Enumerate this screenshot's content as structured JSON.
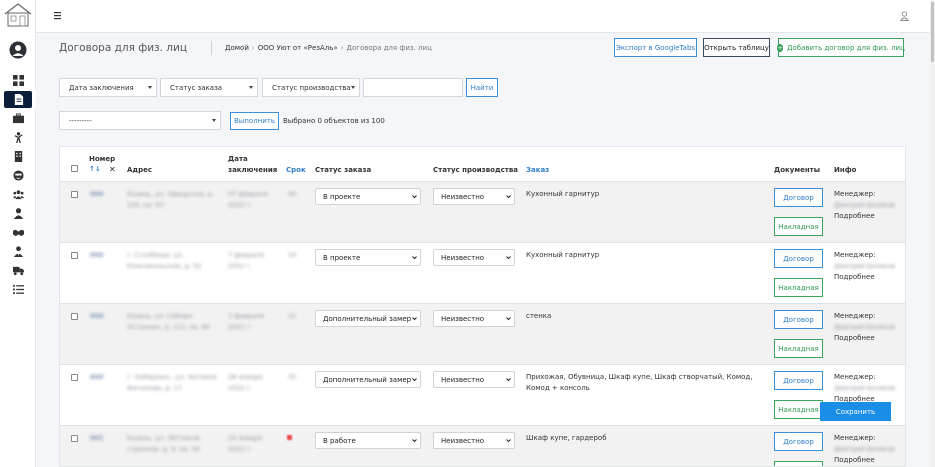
{
  "header": {
    "page_title": "Договора для физ. лиц",
    "breadcrumb": {
      "home": "Домой",
      "company": "ООО Уют от «РезАль»",
      "current": "Договора для физ. лиц"
    },
    "buttons": {
      "export": "Экспорт в GoogleTabs",
      "open_table": "Открыть таблицу",
      "add": "Добавить договор для физ. лиц"
    }
  },
  "filters": {
    "date": "Дата заключения",
    "order_status": "Статус заказа",
    "production_status": "Статус производства",
    "search_value": "",
    "find": "Найти",
    "action": "---------",
    "execute": "Выполнить",
    "selected_info": "Выбрано 0 объектов из 100"
  },
  "table": {
    "columns": {
      "number": "Номер",
      "sort": "↑↓",
      "address": "Адрес",
      "date_line1": "Дата",
      "date_line2": "заключения",
      "term": "Срок",
      "order_status": "Статус заказа",
      "production_status": "Статус производства",
      "order": "Заказ",
      "documents": "Документы",
      "info": "Инфо"
    },
    "rows": [
      {
        "number": "000",
        "address1": "Казань, ул. Заводская, д.",
        "address2": "105, кв. 93",
        "date1": "07 февраля",
        "date2": "2022 г.",
        "term": "00",
        "order_status": "В проекте",
        "production_status": "Неизвестно",
        "order": "Кухонный гарнитур",
        "contract": "Договор",
        "invoice": "Накладная",
        "manager_label": "Менеджер:",
        "manager_name": "Дмитрий Беляков",
        "more": "Подробнее"
      },
      {
        "number": "000",
        "address1": "г. Столбище, ул.",
        "address2": "Комсомольская, д. 52",
        "date1": "7 февраля",
        "date2": "2022 г.",
        "term": "10",
        "order_status": "В проекте",
        "production_status": "Неизвестно",
        "order": "Кухонный гарнитур",
        "contract": "Договор",
        "invoice": "Накладная",
        "manager_label": "Менеджер:",
        "manager_name": "Дмитрий Беляков",
        "more": "Подробнее"
      },
      {
        "number": "000",
        "address1": "Казань, ул. Собора",
        "address2": "Останкин, д. 111, кв. 96",
        "date1": "3 февраля",
        "date2": "2022 г.",
        "term": "21",
        "order_status": "Дополнительный замер",
        "production_status": "Неизвестно",
        "order": "стенка",
        "contract": "Договор",
        "invoice": "Накладная",
        "manager_label": "Менеджер:",
        "manager_name": "Дмитрий Беляков",
        "more": "Подробнее"
      },
      {
        "number": "000",
        "address1": "г. Набережн., ул. Ахтямов",
        "address2": "Фатыхова, д. 17",
        "date1": "28 января",
        "date2": "2022 г.",
        "term": "35",
        "order_status": "Дополнительный замер",
        "production_status": "Неизвестно",
        "order": "Прихожая, Обувница, Шкаф купе, Шкаф створчатый, Комод, Комод + консоль",
        "contract": "Договор",
        "invoice": "Накладная",
        "manager_label": "Менеджер:",
        "manager_name": "Дмитрий Беляков",
        "more": "Подробнее"
      },
      {
        "number": "001",
        "address1": "Казань, ул. Лётчиков",
        "address2": "стрелков, д. 6, кв. 34",
        "date1": "24 января",
        "date2": "2022 г.",
        "term": "",
        "order_status": "В работе",
        "production_status": "Неизвестно",
        "order": "Шкаф купе, гардероб",
        "contract": "Договор",
        "invoice": "Накладная",
        "manager_label": "Менеджер:",
        "manager_name": "Дмитрий Беляков",
        "more": "Подробнее"
      }
    ]
  },
  "save": "Сохранить",
  "colors": {
    "primary": "#2e7fc8",
    "success": "#2d9a4f",
    "sidebar_active": "#0c1f3a",
    "save_bg": "#1a8ee6",
    "danger": "#e94b4b"
  },
  "icons": [
    "house-logo-icon",
    "user-avatar-icon",
    "dashboard-icon",
    "document-icon",
    "briefcase-icon",
    "worker-icon",
    "building-icon",
    "face-icon",
    "users-icon",
    "user-icon",
    "handshake-icon",
    "user-tie-icon",
    "truck-icon",
    "list-icon",
    "menu-icon",
    "account-icon"
  ]
}
